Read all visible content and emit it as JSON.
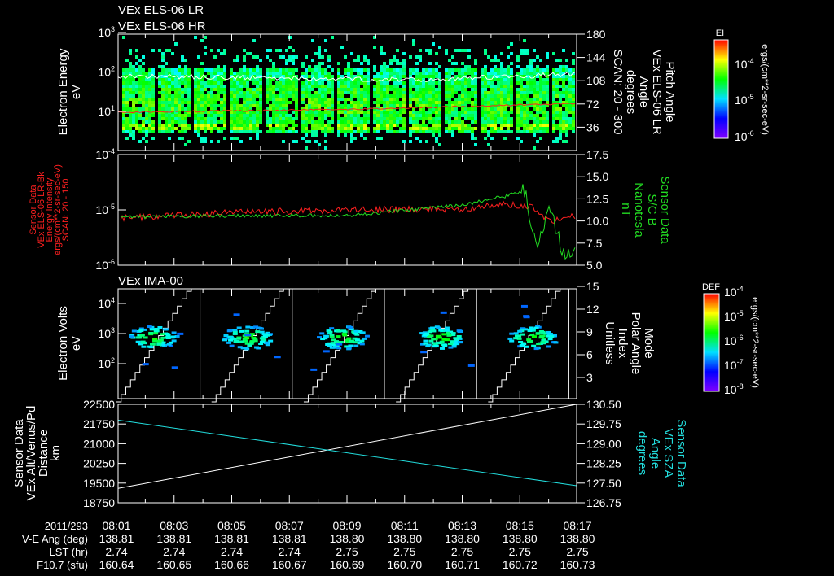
{
  "header": {
    "line1": "VEx ELS-06 LR",
    "line2": "VEx ELS-06 HR"
  },
  "colors": {
    "red": "#ff2020",
    "green": "#22dd22",
    "cyan": "#22dddd",
    "white": "#ffffff"
  },
  "chart_data": [
    {
      "type": "heatmap",
      "title": "VEx ELS-06 LR / HR",
      "ylabel": [
        "Electron Energy",
        "eV"
      ],
      "yticks": [
        "10^1",
        "10^2",
        "10^3"
      ],
      "ylim_log10": [
        0.03,
        3.0
      ],
      "y2label": [
        "Pitch Angle",
        "VEx ELS-06 LR",
        "Angle",
        "degrees",
        "SCAN: 20 - 300"
      ],
      "y2ticks": [
        "36",
        "72",
        "108",
        "144",
        "180"
      ],
      "y2lim": [
        0,
        180
      ],
      "colorbar": {
        "title": "EI",
        "ticks": [
          "10^-4",
          "10^-5",
          "10^-6"
        ],
        "unit": "ergs/(cm**2-sr-sec-eV)"
      },
      "band_log10_eV": [
        0.5,
        2.1
      ],
      "red_line_log10_eV": [
        0.98,
        1.05,
        1.2
      ],
      "white_line_log10_eV": [
        1.9,
        1.85,
        1.8,
        1.95
      ]
    },
    {
      "type": "line",
      "ylabel": [
        "Sensor Data",
        "VEx ELS-06 LR-Bk",
        "Energy Intensity",
        "ergs/(cm**2-sr-sec-eV)",
        "SCAN: 20 - 150"
      ],
      "yticks": [
        "10^-4",
        "10^-5",
        "10^-6"
      ],
      "ylim_log10": [
        -6,
        -4
      ],
      "y2label": [
        "Sensor Data",
        "S/C B",
        "Nanotesla",
        "nT"
      ],
      "y2ticks": [
        "5.0",
        "7.5",
        "10.0",
        "12.5",
        "15.0",
        "17.5"
      ],
      "y2lim": [
        5.0,
        17.5
      ],
      "series": [
        {
          "name": "ELS-06 LR-Bk energy intensity (log10)",
          "color": "red",
          "x_min": [
            0,
            4,
            8,
            12,
            13.5,
            14.5,
            15,
            16
          ],
          "values": [
            -5.15,
            -5.05,
            -5.0,
            -4.98,
            -4.9,
            -4.95,
            -5.2,
            -5.1
          ]
        },
        {
          "name": "S/C B (nT)",
          "color": "green",
          "x_min": [
            0,
            4,
            8,
            12,
            13.5,
            14.2,
            14.6,
            15,
            15.5,
            16
          ],
          "values": [
            10.4,
            10.6,
            10.6,
            11.8,
            12.8,
            13.5,
            6.0,
            12.0,
            6.5,
            7.0
          ]
        }
      ]
    },
    {
      "type": "heatmap",
      "title": "VEx IMA-00",
      "ylabel": [
        "Electron Volts",
        "eV"
      ],
      "yticks": [
        "10^2",
        "10^3",
        "10^4"
      ],
      "ylim_log10": [
        0.85,
        4.5
      ],
      "y2label": [
        "Mode",
        "Polar Angle",
        "Index",
        "Unitless"
      ],
      "y2ticks": [
        "3",
        "6",
        "9",
        "12",
        "15"
      ],
      "y2lim": [
        0.2,
        15
      ],
      "colorbar": {
        "title": "DEF",
        "ticks": [
          "10^-4",
          "10^-5",
          "10^-6",
          "10^-7",
          "10^-8"
        ],
        "unit": "ergs/(cm**2-sr-sec-eV)"
      },
      "scan_starts_min": [
        0,
        3.3,
        6.5,
        9.7,
        12.9
      ],
      "scan_ends_min": [
        2.6,
        5.8,
        9.0,
        12.2,
        15.4
      ],
      "blob_centers_min": [
        1.2,
        4.5,
        7.8,
        11.2,
        14.4
      ],
      "blob_log10_eV": 2.9
    },
    {
      "type": "line",
      "ylabel": [
        "Sensor Data",
        "VEx Alt/Venus/Pd",
        "Distance",
        "km"
      ],
      "yticks": [
        "18750",
        "19500",
        "20250",
        "21000",
        "21750",
        "22500"
      ],
      "ylim": [
        18750,
        22500
      ],
      "y2label": [
        "Sensor Data",
        "VEx SZA",
        "Angle",
        "degrees"
      ],
      "y2ticks": [
        "126.75",
        "127.50",
        "128.25",
        "129.00",
        "129.75",
        "130.50"
      ],
      "y2lim": [
        126.75,
        130.5
      ],
      "series": [
        {
          "name": "VEx Alt (km)",
          "color": "white",
          "x_min": [
            0,
            16
          ],
          "values": [
            19300,
            22500
          ]
        },
        {
          "name": "VEx SZA (deg)",
          "color": "cyan",
          "x_min": [
            0,
            16
          ],
          "values": [
            129.9,
            127.4
          ]
        }
      ]
    }
  ],
  "xaxis": {
    "date_label": "2011/293",
    "rows": [
      {
        "label": "V-E Ang (deg)",
        "values": [
          "138.81",
          "138.81",
          "138.81",
          "138.81",
          "138.80",
          "138.80",
          "138.80",
          "138.80",
          "138.80"
        ]
      },
      {
        "label": "LST (hr)",
        "values": [
          "2.74",
          "2.74",
          "2.74",
          "2.74",
          "2.75",
          "2.75",
          "2.75",
          "2.75",
          "2.75"
        ]
      },
      {
        "label": "F10.7 (sfu)",
        "values": [
          "160.64",
          "160.65",
          "160.66",
          "160.67",
          "160.69",
          "160.70",
          "160.71",
          "160.72",
          "160.73"
        ]
      }
    ],
    "times": [
      "08:01",
      "08:03",
      "08:05",
      "08:07",
      "08:09",
      "08:11",
      "08:13",
      "08:15",
      "08:17"
    ]
  }
}
